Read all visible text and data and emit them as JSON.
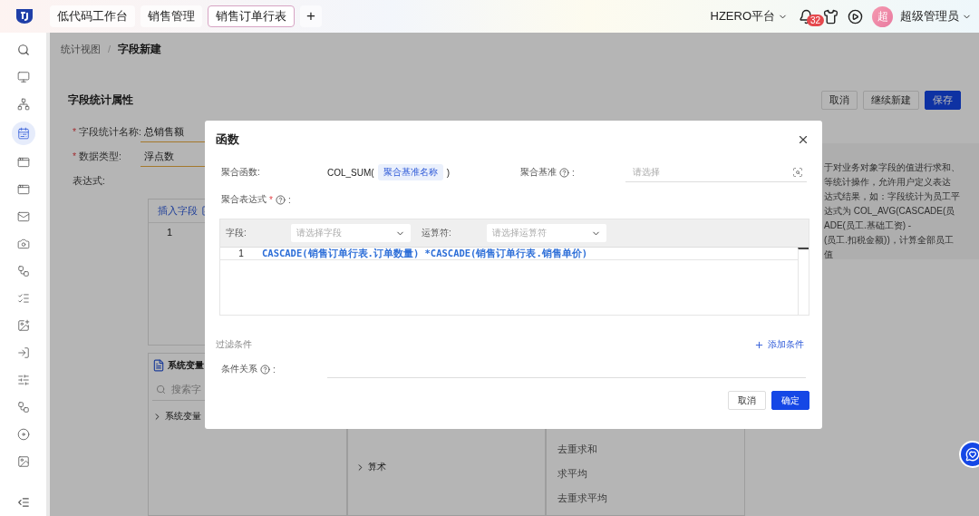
{
  "top_bar": {
    "tabs": [
      {
        "label": "低代码工作台",
        "selected": false
      },
      {
        "label": "销售管理",
        "selected": false
      },
      {
        "label": "销售订单行表",
        "selected": true
      }
    ],
    "add_tab": "+",
    "platform": "HZERO平台",
    "notification_count": "32",
    "avatar": "超",
    "user": "超级管理员"
  },
  "sidebar": {
    "items": [
      {
        "selected": false
      },
      {
        "selected": false
      },
      {
        "selected": true
      },
      {
        "selected": false
      },
      {
        "selected": false
      },
      {
        "selected": false
      },
      {
        "selected": false
      },
      {
        "selected": false
      },
      {
        "selected": false
      },
      {
        "selected": false
      },
      {
        "selected": false
      },
      {
        "selected": false
      },
      {
        "selected": false
      },
      {
        "selected": false
      },
      {
        "selected": false
      }
    ]
  },
  "breadcrumb": {
    "items": [
      "统计视图",
      "字段新建"
    ],
    "separator": "/"
  },
  "page": {
    "title": "字段统计属性",
    "buttons": [
      {
        "label": "取消",
        "kind": "default"
      },
      {
        "label": "继续新建",
        "kind": "default"
      },
      {
        "label": "保存",
        "kind": "primary"
      }
    ],
    "fields": [
      {
        "required_mark": "*",
        "label": "字段统计名称:",
        "value": "总销售额"
      },
      {
        "required_mark": "*",
        "label": "数据类型:",
        "value": "浮点数"
      }
    ],
    "expression_label": "表达式:",
    "editor": {
      "tab": "插入字段",
      "line": "1"
    },
    "variables_panel": {
      "title": "系统变量",
      "search_placeholder": "搜索字",
      "tree": [
        "系统变量"
      ]
    },
    "function_groups": [
      "算术"
    ],
    "functions": [
      "去重求和",
      "求平均",
      "去重求平均"
    ],
    "help_lines": [
      "于对业务对象字段的值进行求和、",
      "等统计操作，允许用户定义表达",
      "达式结果，如：字段统计为员工平",
      "达式为 COL_AVG(CASCADE(员",
      "ADE(员工.基础工资) -",
      "(员工.扣税金额))，计算全部员工",
      "值"
    ]
  },
  "dialog": {
    "title": "函数",
    "aggregate_label": "聚合函数:",
    "function_name": "COL_SUM(",
    "function_tag": "聚合基准名称",
    "function_close": ")",
    "basis_label": "聚合基准",
    "basis_colon": ":",
    "basis_placeholder": "请选择",
    "expression_label": "聚合表达式",
    "expression_required_mark": "*",
    "expression_colon": ":",
    "field_label": "字段:",
    "field_placeholder": "请选择字段",
    "operator_label": "运算符:",
    "operator_placeholder": "请选择运算符",
    "code_lines": [
      {
        "number": "1",
        "code": "CASCADE(销售订单行表.订单数量) *CASCADE(销售订单行表.销售单价)"
      }
    ],
    "filter_title": "过滤条件",
    "add_condition": "添加条件",
    "relation_label": "条件关系",
    "relation_colon": ":",
    "buttons": [
      {
        "label": "取消",
        "kind": "default"
      },
      {
        "label": "确定",
        "kind": "primary"
      }
    ]
  }
}
